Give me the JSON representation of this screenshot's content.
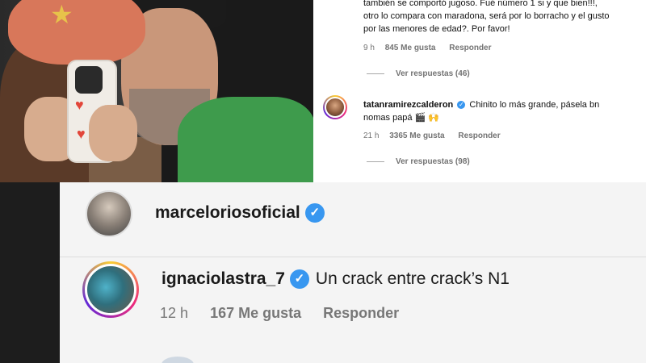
{
  "top": {
    "first_comment_lines": [
      "también se comportó jugoso. Fué número 1 si y que bien!!!,",
      "otro lo compara con maradona, será por lo borracho y el gusto",
      "por las menores de edad?. Por favor!"
    ],
    "first_meta": {
      "time": "9 h",
      "likes": "845 Me gusta",
      "reply": "Responder"
    },
    "first_replies": "Ver respuestas (46)",
    "second_comment": {
      "username": "tatanramirezcalderon",
      "text_line1": "Chinito lo más grande, pásela bn",
      "text_line2": "nomas papá 🎬 🙌"
    },
    "second_meta": {
      "time": "21 h",
      "likes": "3365 Me gusta",
      "reply": "Responder"
    },
    "second_replies": "Ver respuestas (98)"
  },
  "bottom": {
    "comment1": {
      "username": "marceloriosoficial"
    },
    "comment2": {
      "username": "ignaciolastra_7",
      "text": "Un crack entre crack’s N1"
    },
    "meta": {
      "time": "12 h",
      "likes": "167 Me gusta",
      "reply": "Responder"
    }
  },
  "icons": {
    "verified": "verified-badge-icon",
    "star": "star-icon"
  },
  "colors": {
    "verified_blue": "#3897f0",
    "meta_gray": "#737373",
    "story_ring": "#ee2a7b"
  }
}
